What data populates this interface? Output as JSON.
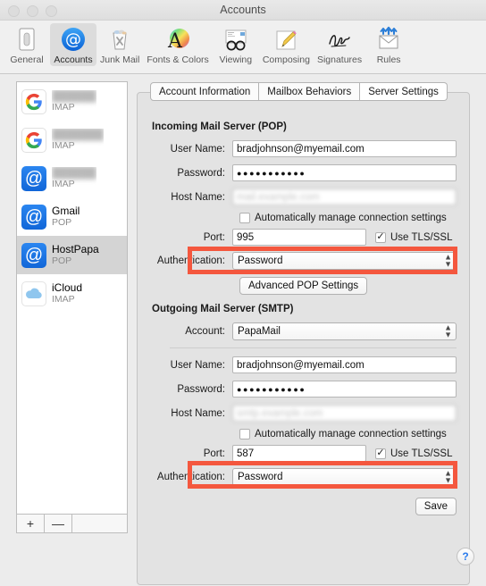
{
  "window": {
    "title": "Accounts"
  },
  "toolbar": {
    "items": [
      {
        "label": "General",
        "icon": "general-switch-icon",
        "selected": false
      },
      {
        "label": "Accounts",
        "icon": "accounts-at-icon",
        "selected": true
      },
      {
        "label": "Junk Mail",
        "icon": "junk-mail-trash-icon",
        "selected": false
      },
      {
        "label": "Fonts & Colors",
        "icon": "fonts-colors-icon",
        "selected": false
      },
      {
        "label": "Viewing",
        "icon": "viewing-glasses-icon",
        "selected": false
      },
      {
        "label": "Composing",
        "icon": "composing-pencil-icon",
        "selected": false
      },
      {
        "label": "Signatures",
        "icon": "signatures-icon",
        "selected": false
      },
      {
        "label": "Rules",
        "icon": "rules-envelope-icon",
        "selected": false
      }
    ]
  },
  "sidebar": {
    "accounts": [
      {
        "name": "",
        "protocol": "IMAP",
        "icon": "google-icon",
        "redacted": true,
        "selected": false
      },
      {
        "name": "",
        "protocol": "IMAP",
        "icon": "google-icon",
        "redacted": true,
        "selected": false
      },
      {
        "name": "",
        "protocol": "IMAP",
        "icon": "at-icon",
        "redacted": true,
        "selected": false
      },
      {
        "name": "Gmail",
        "protocol": "POP",
        "icon": "at-icon",
        "redacted": false,
        "selected": false
      },
      {
        "name": "HostPapa",
        "protocol": "POP",
        "icon": "at-icon",
        "redacted": false,
        "selected": true
      },
      {
        "name": "iCloud",
        "protocol": "IMAP",
        "icon": "cloud-icon",
        "redacted": false,
        "selected": false
      }
    ],
    "add_label": "+",
    "remove_label": "—"
  },
  "tabs": [
    {
      "label": "Account Information",
      "active": false
    },
    {
      "label": "Mailbox Behaviors",
      "active": false
    },
    {
      "label": "Server Settings",
      "active": true
    }
  ],
  "incoming": {
    "section_title": "Incoming Mail Server (POP)",
    "user_name_label": "User Name:",
    "user_name_value": "bradjohnson@myemail.com",
    "password_label": "Password:",
    "password_value": "●●●●●●●●●●●",
    "host_name_label": "Host Name:",
    "host_name_value": "mail.example.com",
    "auto_manage_label": "Automatically manage connection settings",
    "auto_manage_checked": false,
    "port_label": "Port:",
    "port_value": "995",
    "tls_label": "Use TLS/SSL",
    "tls_checked": true,
    "auth_label": "Authentication:",
    "auth_value": "Password",
    "advanced_label": "Advanced POP Settings"
  },
  "outgoing": {
    "section_title": "Outgoing Mail Server (SMTP)",
    "account_label": "Account:",
    "account_value": "PapaMail",
    "user_name_label": "User Name:",
    "user_name_value": "bradjohnson@myemail.com",
    "password_label": "Password:",
    "password_value": "●●●●●●●●●●●",
    "host_name_label": "Host Name:",
    "host_name_value": "smtp.example.com",
    "auto_manage_label": "Automatically manage connection settings",
    "auto_manage_checked": false,
    "port_label": "Port:",
    "port_value": "587",
    "tls_label": "Use TLS/SSL",
    "tls_checked": true,
    "auth_label": "Authentication:",
    "auth_value": "Password"
  },
  "footer": {
    "save_label": "Save",
    "help_label": "?"
  },
  "colors": {
    "highlight": "#f4573e",
    "accent_blue": "#1a73e8",
    "selected_row": "#d4d4d4"
  }
}
